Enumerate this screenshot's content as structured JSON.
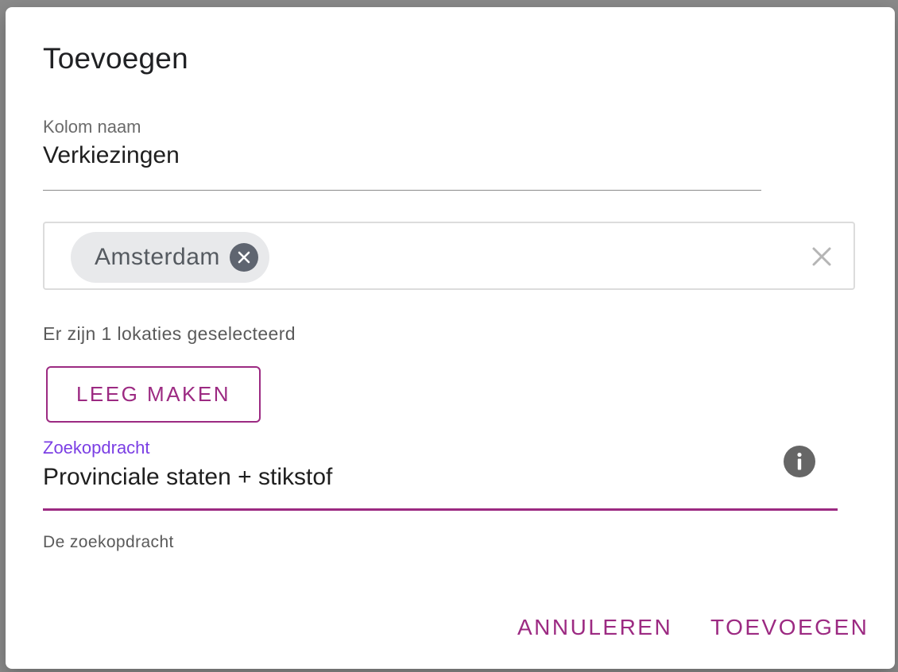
{
  "dialog": {
    "title": "Toevoegen"
  },
  "column_name": {
    "label": "Kolom naam",
    "value": "Verkiezingen"
  },
  "locations": {
    "chips": [
      {
        "label": "Amsterdam"
      }
    ],
    "remove_chip_icon": "close-circle-icon",
    "clear_icon": "close-icon",
    "summary": "Er zijn 1 lokaties geselecteerd",
    "clear_button_label": "LEEG MAKEN"
  },
  "search": {
    "label": "Zoekopdracht",
    "value": "Provinciale staten + stikstof",
    "helper": "De zoekopdracht",
    "info_icon": "info-icon"
  },
  "actions": {
    "cancel_label": "ANNULEREN",
    "submit_label": "TOEVOEGEN"
  },
  "colors": {
    "accent": "#9c2a82",
    "focus_label": "#7b3fe4",
    "chip_background": "#e8e9eb"
  }
}
